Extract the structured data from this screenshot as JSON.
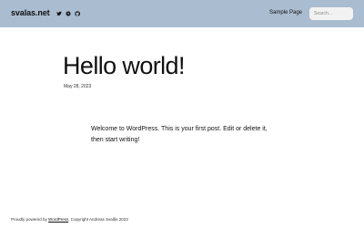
{
  "header": {
    "site_title": "svalas.net",
    "social": [
      {
        "icon": "twitter-icon"
      },
      {
        "icon": "mastodon-icon"
      },
      {
        "icon": "github-icon"
      }
    ],
    "nav": [
      {
        "label": "Sample Page"
      }
    ],
    "search": {
      "placeholder": "Search...",
      "value": ""
    },
    "background_color": "#a9bcd0"
  },
  "post": {
    "title": "Hello world!",
    "date": "May 28, 2023",
    "content": "Welcome to WordPress. This is your first post. Edit or delete it, then start writing!"
  },
  "footer": {
    "prefix": "Proudly powered by ",
    "link_label": "WordPress",
    "suffix": ". Copyright Andreas Svalås 2023"
  }
}
